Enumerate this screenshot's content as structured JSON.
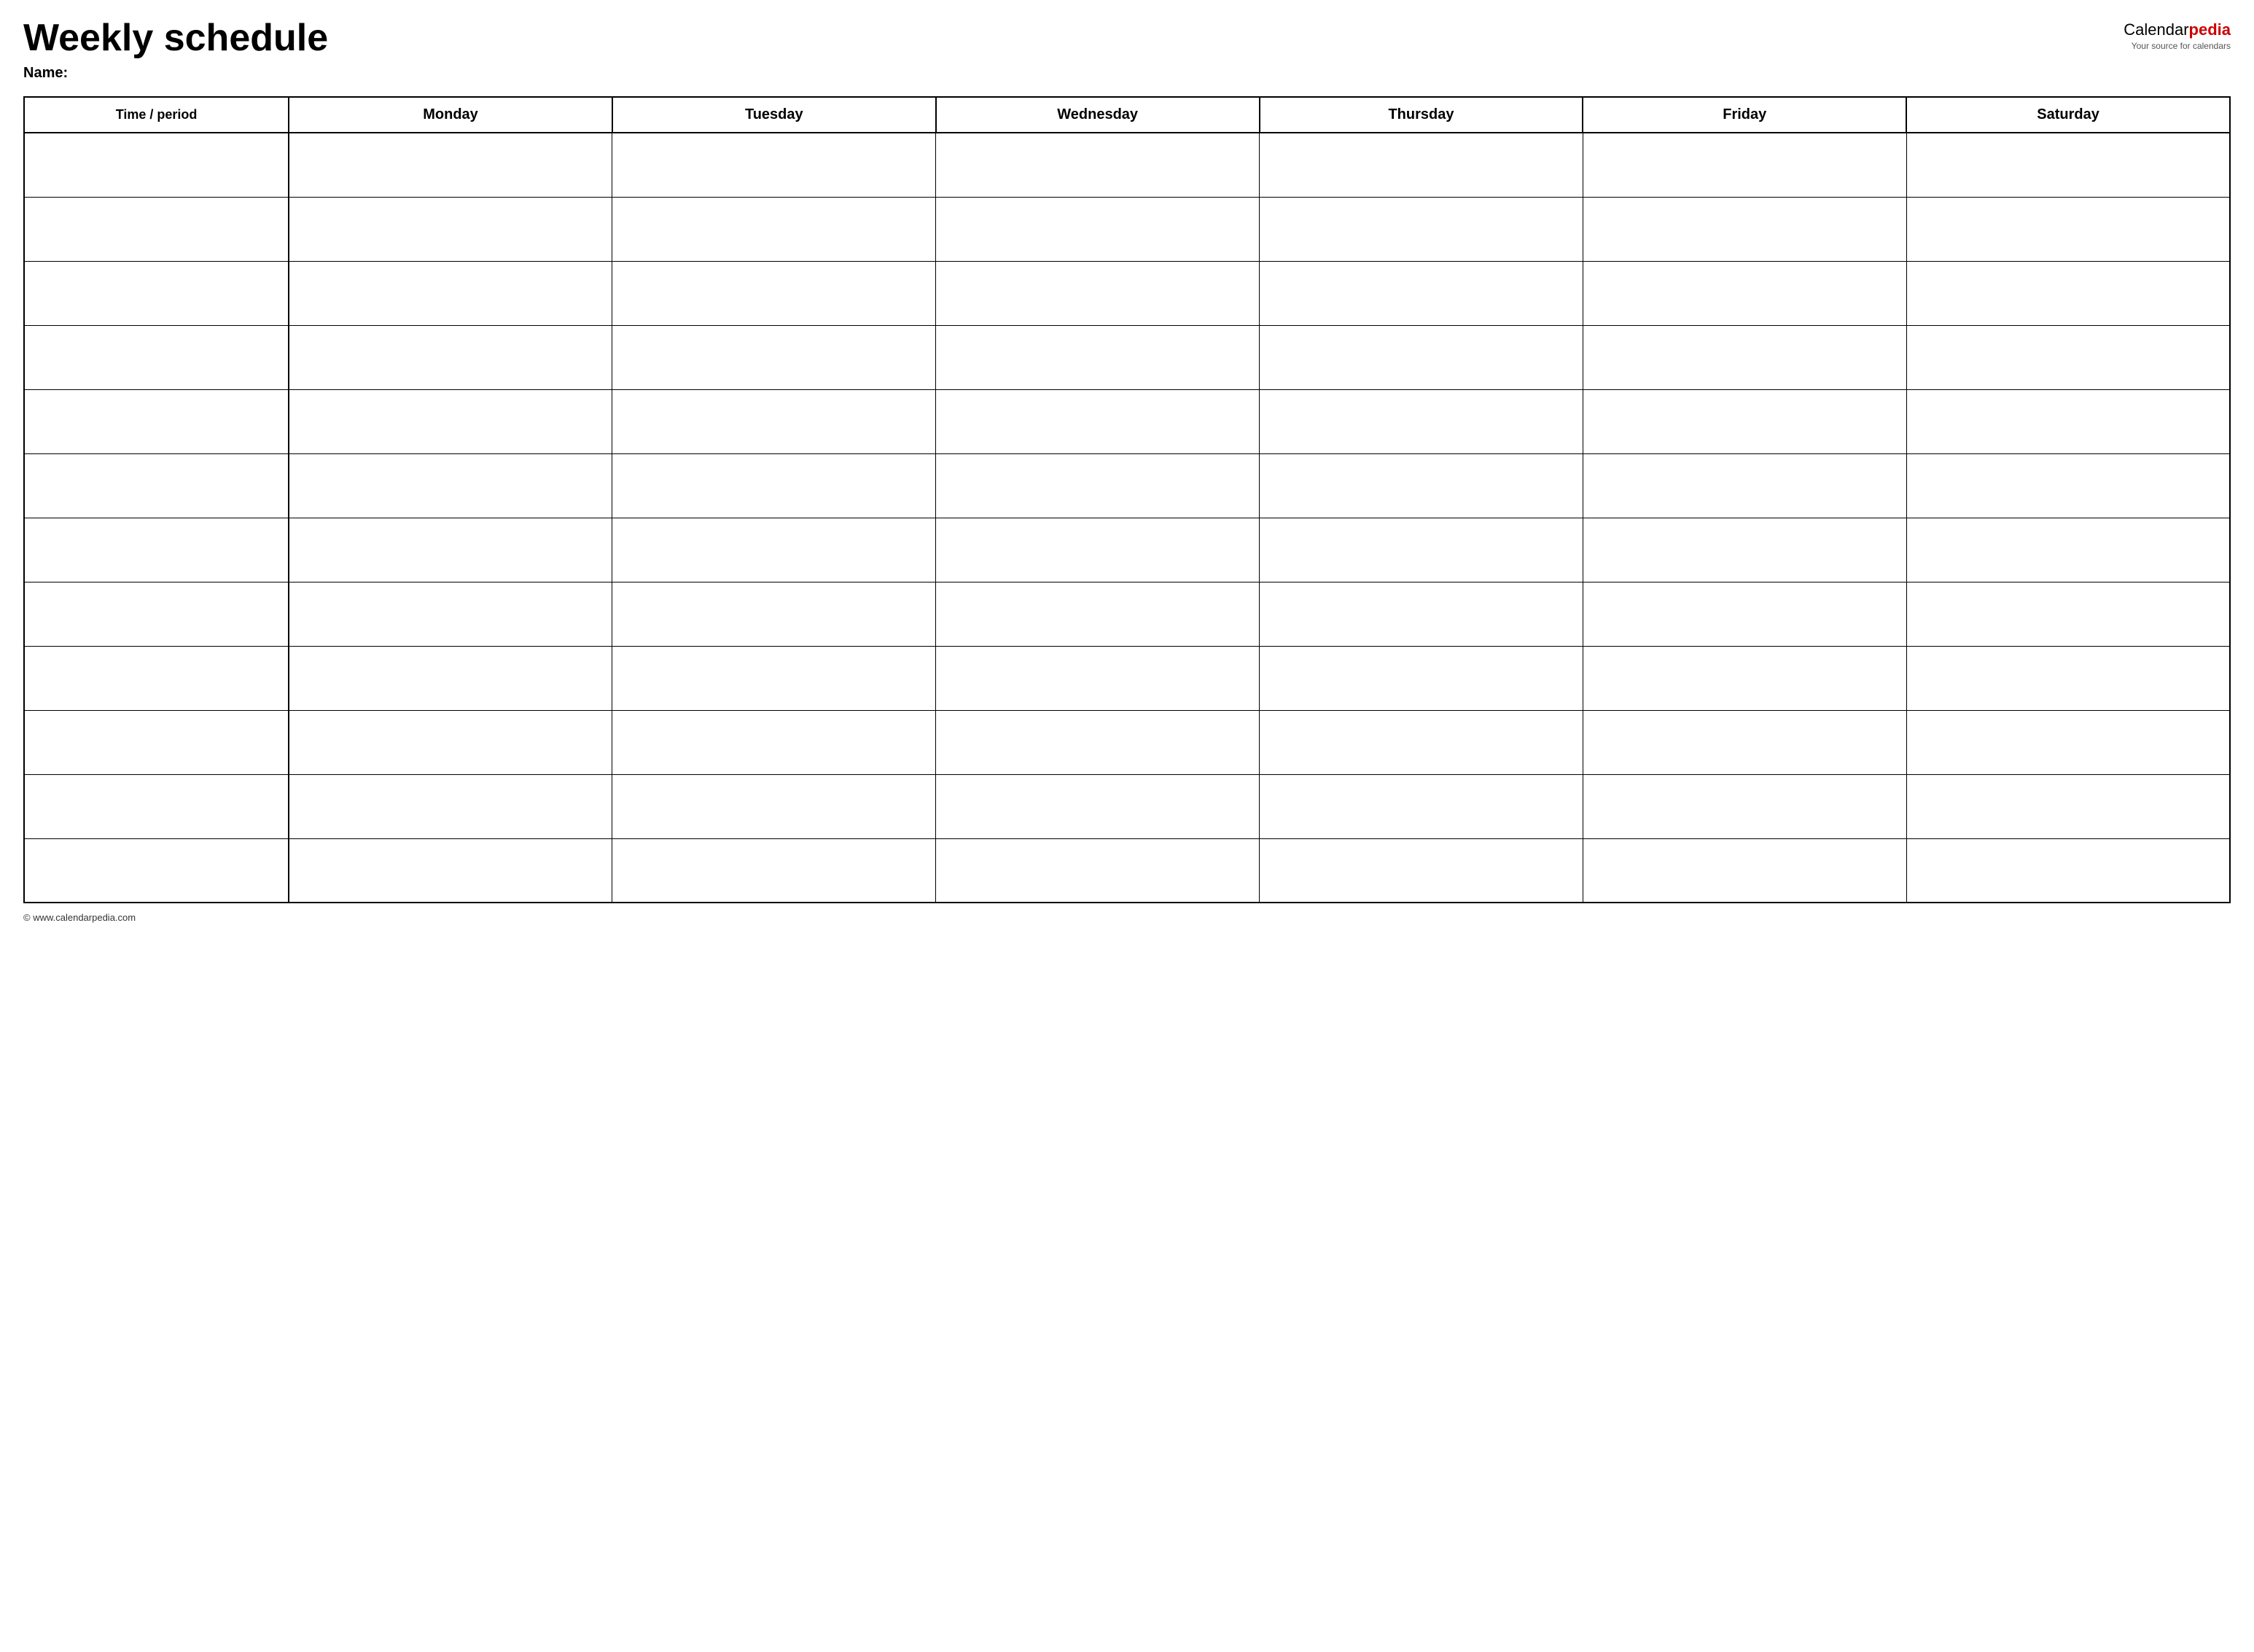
{
  "header": {
    "title": "Weekly schedule",
    "logo": {
      "part1": "Calendar",
      "part2": "pedia",
      "subtitle": "Your source for calendars"
    }
  },
  "name_label": "Name:",
  "table": {
    "headers": [
      "Time / period",
      "Monday",
      "Tuesday",
      "Wednesday",
      "Thursday",
      "Friday",
      "Saturday"
    ],
    "rows": 12
  },
  "footer": {
    "url": "© www.calendarpedia.com"
  }
}
